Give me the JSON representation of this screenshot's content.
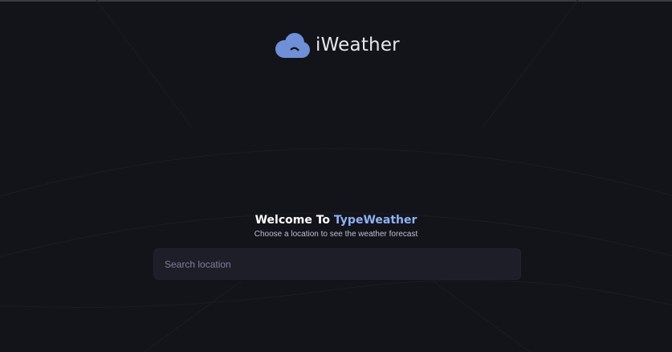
{
  "app": {
    "brand_name": "iWeather",
    "logo_icon": "cloud-logo-icon"
  },
  "welcome": {
    "prefix": "Welcome To",
    "highlight": "TypeWeather",
    "subtitle": "Choose a location to see the weather forecast"
  },
  "search": {
    "placeholder": "Search location",
    "value": ""
  },
  "colors": {
    "background": "#13131a",
    "accent": "#8fb2f5",
    "input_background": "#1e1e29",
    "logo_blue": "#6f8fd6"
  }
}
